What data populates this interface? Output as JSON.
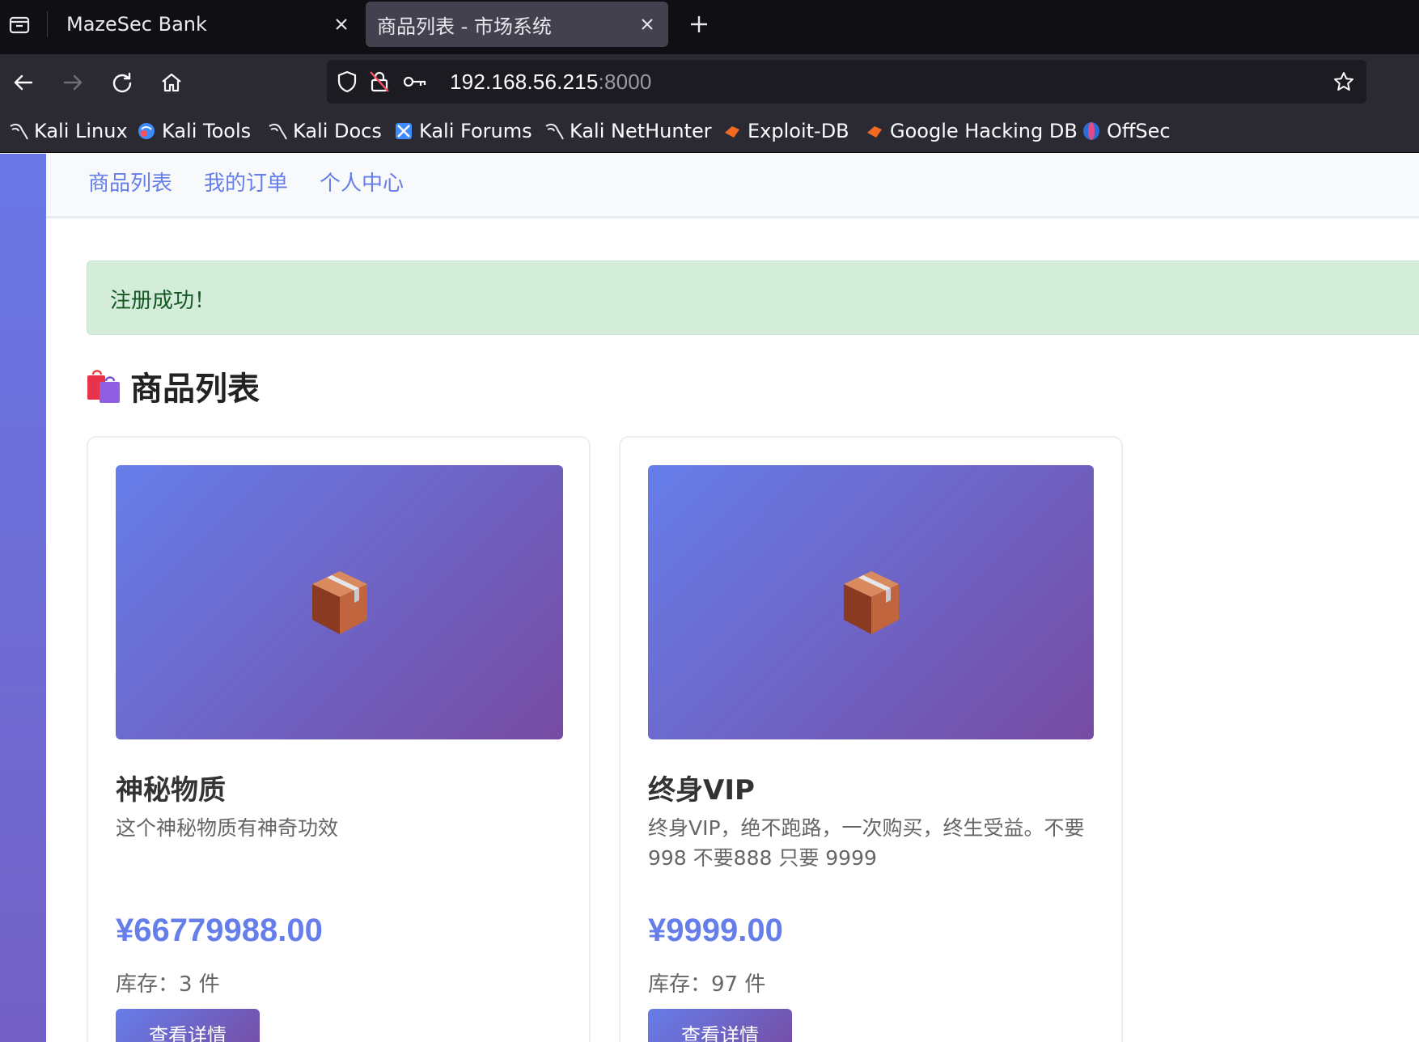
{
  "browser": {
    "tabs": [
      {
        "title": "MazeSec Bank",
        "active": false
      },
      {
        "title": "商品列表 - 市场系统",
        "active": true
      }
    ],
    "url": {
      "host": "192.168.56.215",
      "port": ":8000"
    },
    "bookmarks": [
      {
        "label": "Kali Linux",
        "icon": "kali-dragon-icon"
      },
      {
        "label": "Kali Tools",
        "icon": "kali-tools-icon"
      },
      {
        "label": "Kali Docs",
        "icon": "kali-dragon-icon"
      },
      {
        "label": "Kali Forums",
        "icon": "kali-forums-icon"
      },
      {
        "label": "Kali NetHunter",
        "icon": "kali-dragon-icon"
      },
      {
        "label": "Exploit-DB",
        "icon": "exploit-db-icon"
      },
      {
        "label": "Google Hacking DB",
        "icon": "exploit-db-icon"
      },
      {
        "label": "OffSec",
        "icon": "offsec-icon"
      }
    ]
  },
  "site": {
    "nav": [
      "商品列表",
      "我的订单",
      "个人中心"
    ],
    "alert": "注册成功！",
    "section_title": "商品列表",
    "section_icon": "shopping-bags-icon",
    "products": [
      {
        "name": "神秘物质",
        "description": "这个神秘物质有神奇功效",
        "price": "¥66779988.00",
        "stock": "库存：3 件",
        "button": "查看详情",
        "image_icon": "package-icon"
      },
      {
        "name": "终身VIP",
        "description": "终身VIP，绝不跑路，一次购买，终生受益。不要998 不要888 只要 9999",
        "price": "¥9999.00",
        "stock": "库存：97 件",
        "button": "查看详情",
        "image_icon": "package-icon"
      }
    ],
    "colors": {
      "accent": "#667eea",
      "gradient_end": "#764ba2",
      "alert_bg": "#d4edda",
      "alert_text": "#155724"
    }
  }
}
